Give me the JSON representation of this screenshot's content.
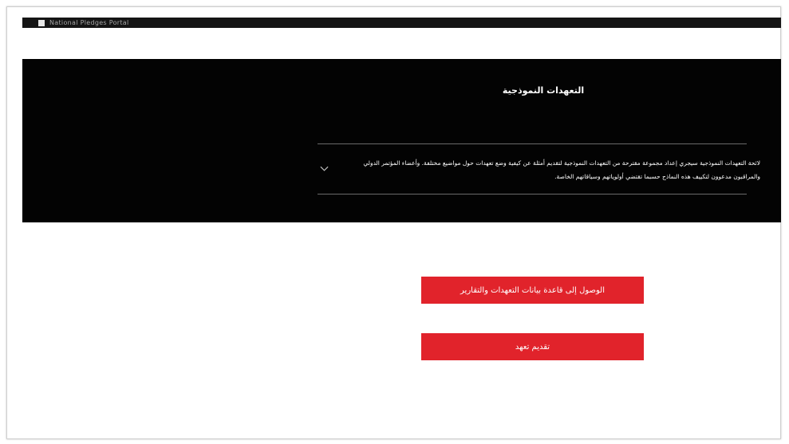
{
  "header": {
    "brand": "National Pledges Portal"
  },
  "hero": {
    "title": "التعهدات النموذجية",
    "accordion": {
      "text": "لائحة التعهدات النموذجية سيجري إعداد مجموعة مقترحة من التعهدات النموذجية لتقديم أمثلة عن كيفية وضع تعهدات حول مواضيع مختلفة. وأعضاء المؤتمر الدولي والمراقبون مدعوون لتكييف هذه النماذج حسبما تقتضي أولوياتهم وسياقاتهم الخاصة."
    }
  },
  "actions": {
    "primary_label": "الوصول إلى قاعدة بيانات التعهدات والتقارير",
    "secondary_label": "تقديم تعهد"
  },
  "colors": {
    "accent": "#e1232b",
    "hero_background": "#030303",
    "topbar_background": "#151515"
  },
  "icons": {
    "accordion_toggle": "chevron-down-icon"
  }
}
